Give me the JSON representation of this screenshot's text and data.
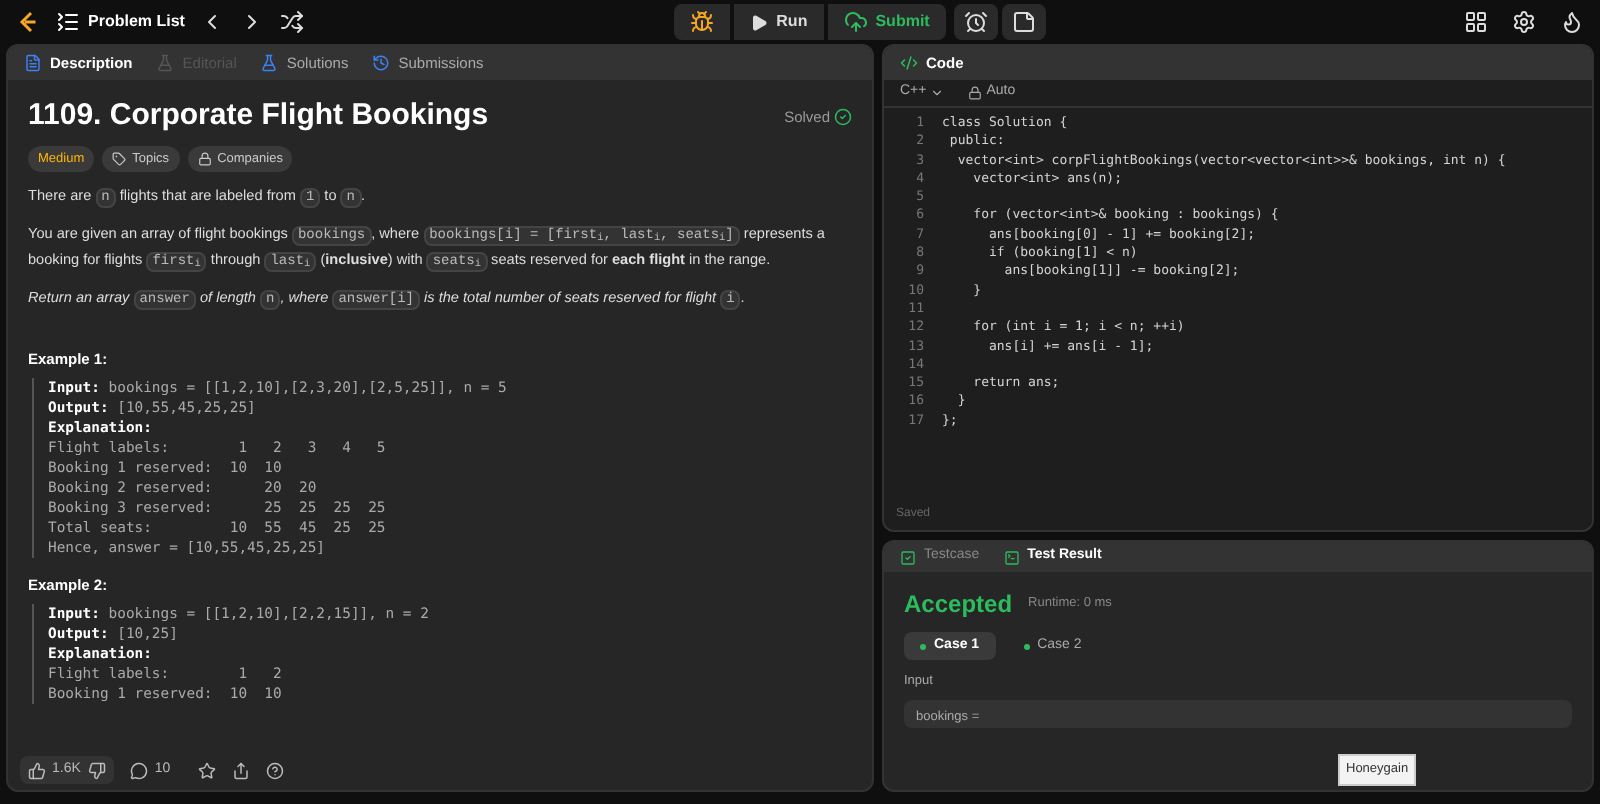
{
  "top_bar": {
    "problem_list": "Problem List",
    "run": "Run",
    "submit": "Submit"
  },
  "description_tabs": [
    {
      "label": "Description",
      "selected": true,
      "disabled": false
    },
    {
      "label": "Editorial",
      "selected": false,
      "disabled": true
    },
    {
      "label": "Solutions",
      "selected": false,
      "disabled": false
    },
    {
      "label": "Submissions",
      "selected": false,
      "disabled": false
    }
  ],
  "problem": {
    "title": "1109. Corporate Flight Bookings",
    "status": "Solved",
    "difficulty": "Medium",
    "tags": [
      "Topics",
      "Companies"
    ],
    "paragraphs": [
      [
        {
          "kind": "text",
          "text": "There are "
        },
        {
          "kind": "code",
          "text": "n"
        },
        {
          "kind": "text",
          "text": " flights that are labeled from "
        },
        {
          "kind": "code",
          "text": "1"
        },
        {
          "kind": "text",
          "text": " to "
        },
        {
          "kind": "code",
          "text": "n"
        },
        {
          "kind": "text",
          "text": "."
        }
      ],
      [
        {
          "kind": "text",
          "text": "You are given an array of flight bookings "
        },
        {
          "kind": "code",
          "text": "bookings"
        },
        {
          "kind": "text",
          "text": ", where "
        },
        {
          "kind": "code",
          "text": "bookings[i] = [first$_{i}$, last$_{i}$, seats$_{i}$]"
        },
        {
          "kind": "text",
          "text": " represents a booking for flights "
        },
        {
          "kind": "code",
          "text": "first$_{i}$"
        },
        {
          "kind": "text",
          "text": " through "
        },
        {
          "kind": "code",
          "text": "last$_{i}$"
        },
        {
          "kind": "text",
          "text": " (**inclusive**) with "
        },
        {
          "kind": "code",
          "text": "seats$_{i}$"
        },
        {
          "kind": "text",
          "text": " seats reserved for **each flight** in the range."
        }
      ],
      [
        {
          "kind": "italic",
          "text": "Return "
        },
        {
          "kind": "italic",
          "text": "an array "
        },
        {
          "kind": "code",
          "text": "answer"
        },
        {
          "kind": "italic",
          "text": " of length "
        },
        {
          "kind": "code",
          "text": "n"
        },
        {
          "kind": "italic",
          "text": ", where "
        },
        {
          "kind": "code",
          "text": "answer[i]"
        },
        {
          "kind": "italic",
          "text": " is the total number of seats reserved for flight "
        },
        {
          "kind": "code",
          "text": "i"
        },
        {
          "kind": "text",
          "text": "."
        }
      ]
    ],
    "examples": [
      {
        "title": "Example 1:",
        "lines": [
          {
            "label": "Input:",
            "text": " bookings = [[1,2,10],[2,3,20],[2,5,25]], n = 5"
          },
          {
            "label": "Output:",
            "text": " [10,55,45,25,25]"
          },
          {
            "label": "Explanation:"
          },
          {
            "text": "Flight labels:        1   2   3   4   5"
          },
          {
            "text": "Booking 1 reserved:  10  10"
          },
          {
            "text": "Booking 2 reserved:      20  20"
          },
          {
            "text": "Booking 3 reserved:      25  25  25  25"
          },
          {
            "text": "Total seats:         10  55  45  25  25"
          },
          {
            "text": "Hence, answer = [10,55,45,25,25]"
          }
        ]
      },
      {
        "title": "Example 2:",
        "lines": [
          {
            "label": "Input:",
            "text": " bookings = [[1,2,10],[2,2,15]], n = 2"
          },
          {
            "label": "Output:",
            "text": " [10,25]"
          },
          {
            "label": "Explanation:"
          },
          {
            "text": "Flight labels:        1   2"
          },
          {
            "text": "Booking 1 reserved:  10  10"
          }
        ]
      }
    ],
    "footer": {
      "likes": "1.6K",
      "comments": "10"
    }
  },
  "code_panel": {
    "title": "Code",
    "language": "C++",
    "mode": "Auto",
    "status": "Saved",
    "lines": [
      {
        "number": "1",
        "text": "class Solution {"
      },
      {
        "number": "2",
        "text": " public:"
      },
      {
        "number": "3",
        "text": "  vector<int> corpFlightBookings(vector<vector<int>>& bookings, int n) {"
      },
      {
        "number": "4",
        "text": "    vector<int> ans(n);"
      },
      {
        "number": "5"
      },
      {
        "number": "6",
        "text": "    for (vector<int>& booking : bookings) {"
      },
      {
        "number": "7",
        "text": "      ans[booking[0] - 1] += booking[2];"
      },
      {
        "number": "8",
        "text": "      if (booking[1] < n)"
      },
      {
        "number": "9",
        "text": "        ans[booking[1]] -= booking[2];"
      },
      {
        "number": "10",
        "text": "    }"
      },
      {
        "number": "11"
      },
      {
        "number": "12",
        "text": "    for (int i = 1; i < n; ++i)"
      },
      {
        "number": "13",
        "text": "      ans[i] += ans[i - 1];"
      },
      {
        "number": "14"
      },
      {
        "number": "15",
        "text": "    return ans;"
      },
      {
        "number": "16",
        "text": "  }"
      },
      {
        "number": "17",
        "text": "};"
      }
    ]
  },
  "result_tabs": [
    {
      "label": "Testcase",
      "selected": false
    },
    {
      "label": "Test Result",
      "selected": true
    }
  ],
  "result": {
    "verdict": "Accepted",
    "runtime": "Runtime: 0 ms",
    "cases": [
      {
        "label": "Case 1",
        "selected": true
      },
      {
        "label": "Case 2",
        "selected": false
      }
    ],
    "input_label": "Input",
    "input_value": "bookings ="
  },
  "tooltip": "Honeygain"
}
